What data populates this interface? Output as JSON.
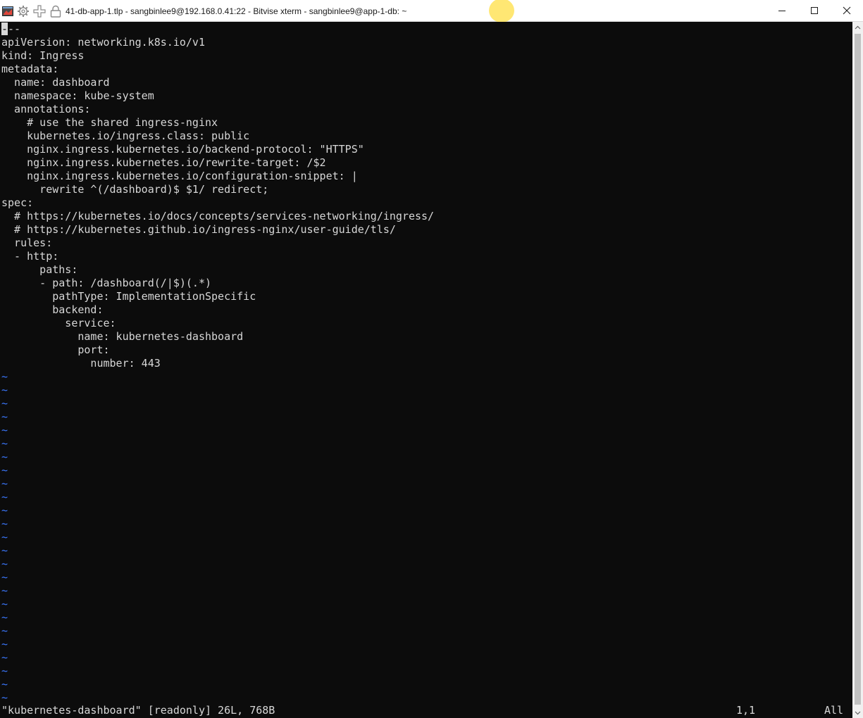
{
  "window": {
    "title": "41-db-app-1.tlp - sangbinlee9@192.168.0.41:22 - Bitvise xterm - sangbinlee9@app-1-db: ~"
  },
  "icons": {
    "app": "bitvise-terminal-icon",
    "settings": "gear-icon",
    "new": "plus-icon",
    "lock": "lock-icon",
    "minimize": "minimize-icon",
    "maximize": "maximize-icon",
    "close": "close-icon"
  },
  "colors": {
    "terminal_bg": "#0c0c0c",
    "text": "#d7d7d7",
    "tilde": "#3b78ff"
  },
  "editor": {
    "cursor_char": "-",
    "line0_rest": "--",
    "lines": [
      "apiVersion: networking.k8s.io/v1",
      "kind: Ingress",
      "metadata:",
      "  name: dashboard",
      "  namespace: kube-system",
      "  annotations:",
      "    # use the shared ingress-nginx",
      "    kubernetes.io/ingress.class: public",
      "    nginx.ingress.kubernetes.io/backend-protocol: \"HTTPS\"",
      "    nginx.ingress.kubernetes.io/rewrite-target: /$2",
      "    nginx.ingress.kubernetes.io/configuration-snippet: |",
      "      rewrite ^(/dashboard)$ $1/ redirect;",
      "spec:",
      "  # https://kubernetes.io/docs/concepts/services-networking/ingress/",
      "  # https://kubernetes.github.io/ingress-nginx/user-guide/tls/",
      "  rules:",
      "  - http:",
      "      paths:",
      "      - path: /dashboard(/|$)(.*)",
      "        pathType: ImplementationSpecific",
      "        backend:",
      "          service:",
      "            name: kubernetes-dashboard",
      "            port:",
      "              number: 443"
    ],
    "tilde": "~",
    "tilde_count": 24
  },
  "status": {
    "message": "\"kubernetes-dashboard\" [readonly] 26L, 768B",
    "position": "1,1",
    "scroll": "All"
  }
}
